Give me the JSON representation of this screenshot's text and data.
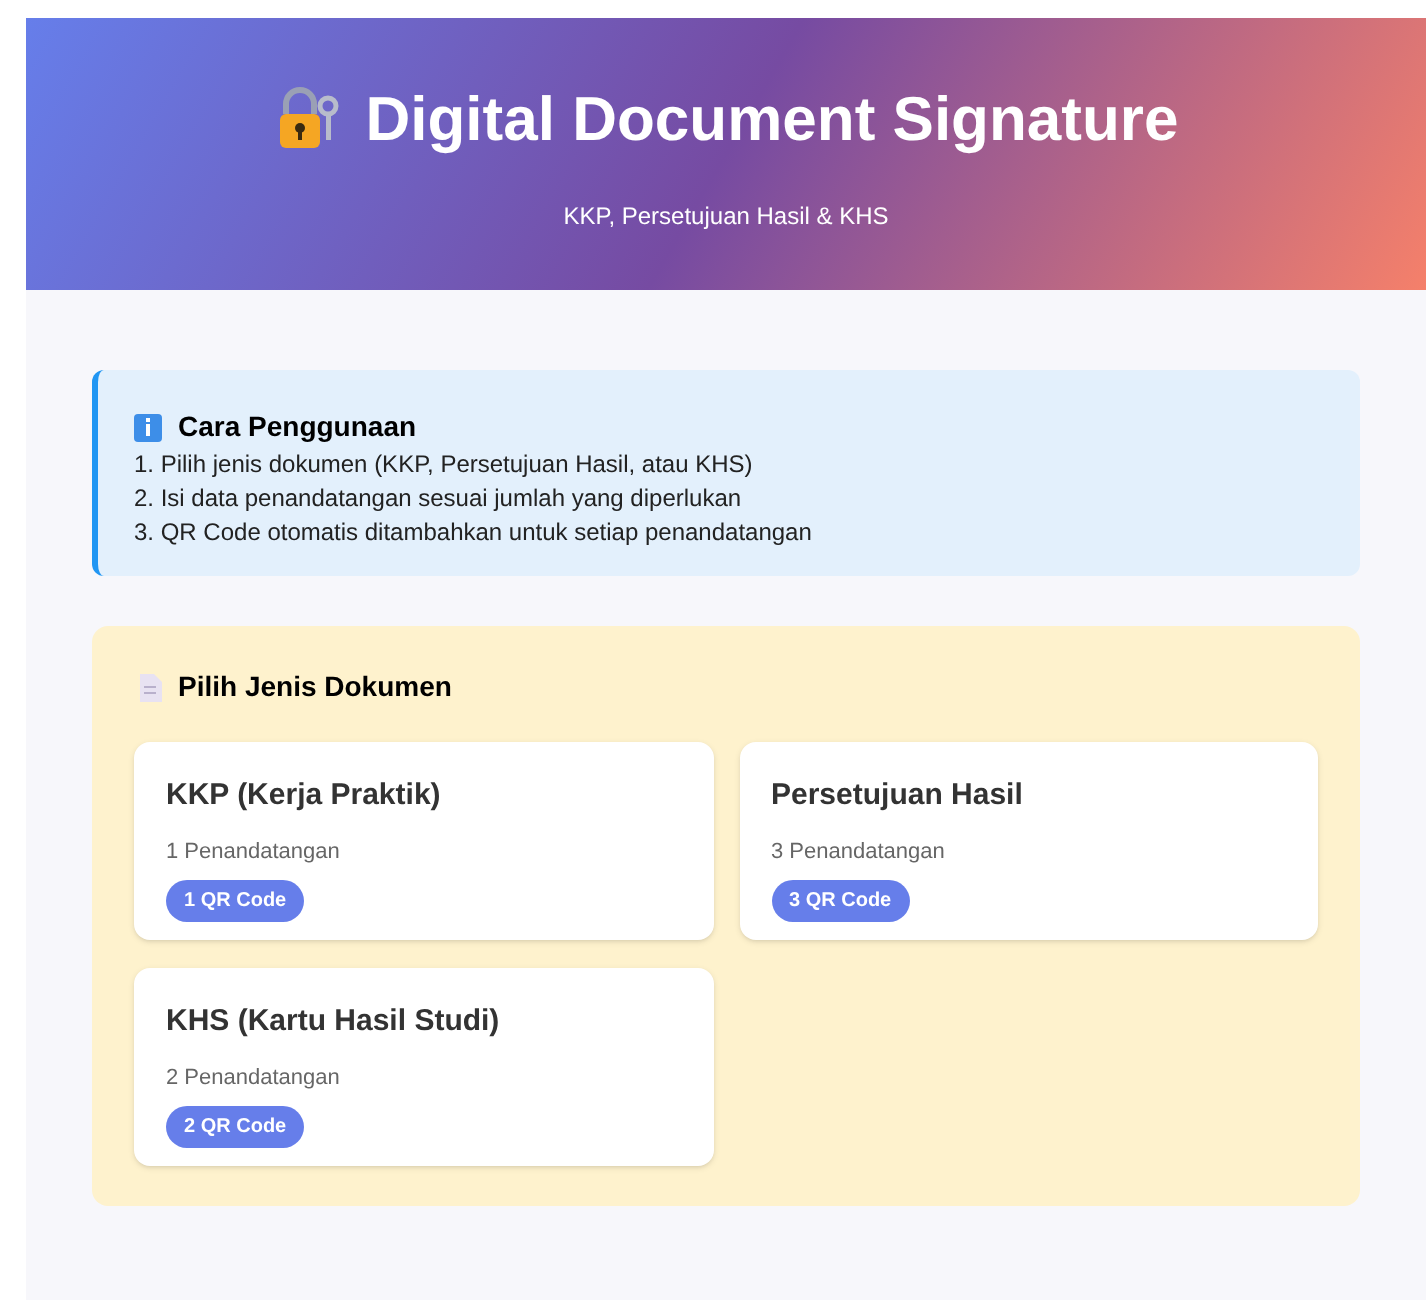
{
  "header": {
    "title": "Digital Document Signature",
    "subtitle": "KKP, Persetujuan Hasil & KHS"
  },
  "instructions": {
    "title": "Cara Penggunaan",
    "steps": [
      "1. Pilih jenis dokumen (KKP, Persetujuan Hasil, atau KHS)",
      "2. Isi data penandatangan sesuai jumlah yang diperlukan",
      "3. QR Code otomatis ditambahkan untuk setiap penandatangan"
    ]
  },
  "document_types": {
    "title": "Pilih Jenis Dokumen",
    "options": [
      {
        "name": "KKP (Kerja Praktik)",
        "signers": "1 Penandatangan",
        "badge": "1 QR Code"
      },
      {
        "name": "Persetujuan Hasil",
        "signers": "3 Penandatangan",
        "badge": "3 QR Code"
      },
      {
        "name": "KHS (Kartu Hasil Studi)",
        "signers": "2 Penandatangan",
        "badge": "2 QR Code"
      }
    ]
  }
}
